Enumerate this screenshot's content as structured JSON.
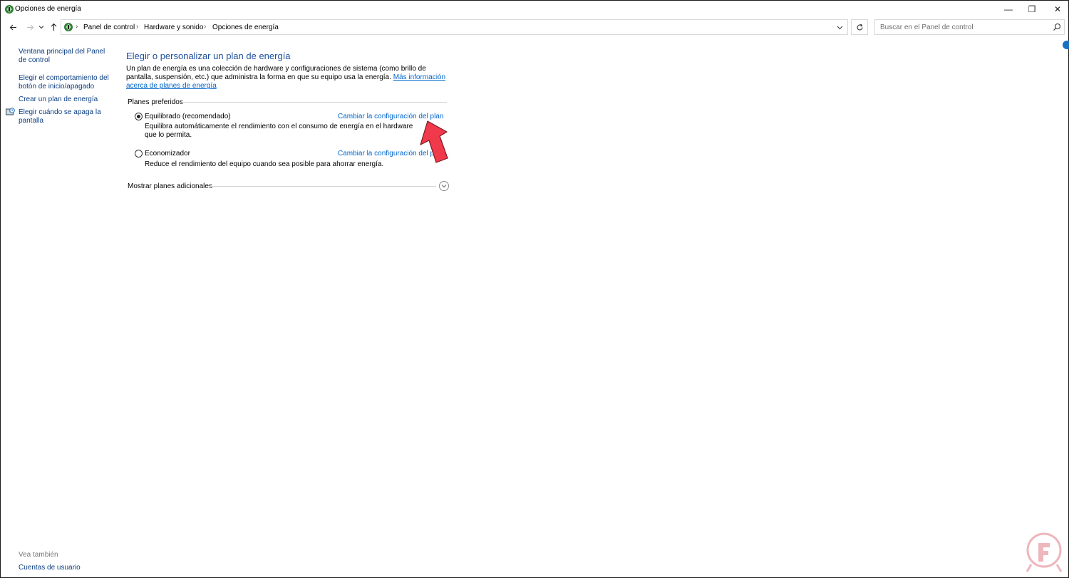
{
  "window": {
    "title": "Opciones de energía",
    "minimize_glyph": "—",
    "maximize_glyph": "❐",
    "close_glyph": "✕"
  },
  "address": {
    "breadcrumbs": [
      "Panel de control",
      "Hardware y sonido",
      "Opciones de energía"
    ],
    "separator": "›",
    "search_placeholder": "Buscar en el Panel de control"
  },
  "sidebar": {
    "items": [
      {
        "label": "Ventana principal del Panel de control"
      },
      {
        "label": "Elegir el comportamiento del botón de inicio/apagado"
      },
      {
        "label": "Crear un plan de energía"
      },
      {
        "label": "Elegir cuándo se apaga la pantalla"
      }
    ],
    "see_also": "Vea también",
    "see_also_items": [
      {
        "label": "Cuentas de usuario"
      }
    ]
  },
  "main": {
    "heading": "Elegir o personalizar un plan de energía",
    "intro_text": "Un plan de energía es una colección de hardware y configuraciones de sistema (como brillo de pantalla, suspensión, etc.) que administra la forma en que su equipo usa la energía.",
    "intro_link": "Más información acerca de planes de energía",
    "preferred_label": "Planes preferidos",
    "plans": [
      {
        "name": "Equilibrado (recomendado)",
        "selected": true,
        "link": "Cambiar la configuración del plan",
        "description": "Equilibra automáticamente el rendimiento con el consumo de energía en el hardware que lo permita."
      },
      {
        "name": "Economizador",
        "selected": false,
        "link": "Cambiar la configuración del plan",
        "description": "Reduce el rendimiento del equipo cuando sea posible para ahorrar energía."
      }
    ],
    "show_more": "Mostrar planes adicionales"
  },
  "colors": {
    "heading": "#1c4f9e",
    "link": "#0066cc",
    "sidebar_link": "#0c3f83",
    "annotation_arrow": "#f0394a"
  }
}
